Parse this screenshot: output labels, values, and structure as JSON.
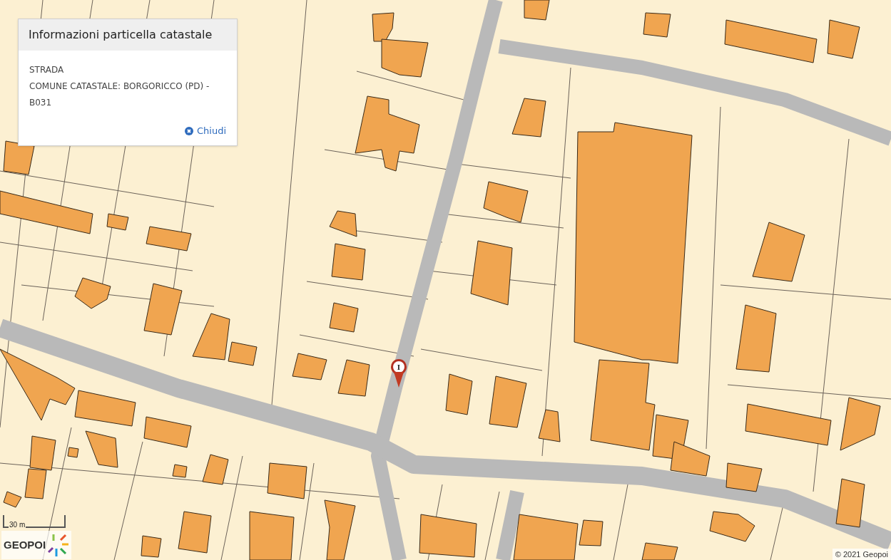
{
  "popup": {
    "title": "Informazioni particella catastale",
    "lines": [
      "STRADA",
      "COMUNE CATASTALE: BORGORICCO (PD) - B031"
    ],
    "close_label": "Chiudi"
  },
  "marker": {
    "label": "I"
  },
  "scale": {
    "label": "30 m"
  },
  "logo": {
    "text": "GEOPOI"
  },
  "attribution": "© 2021 Geopoi"
}
